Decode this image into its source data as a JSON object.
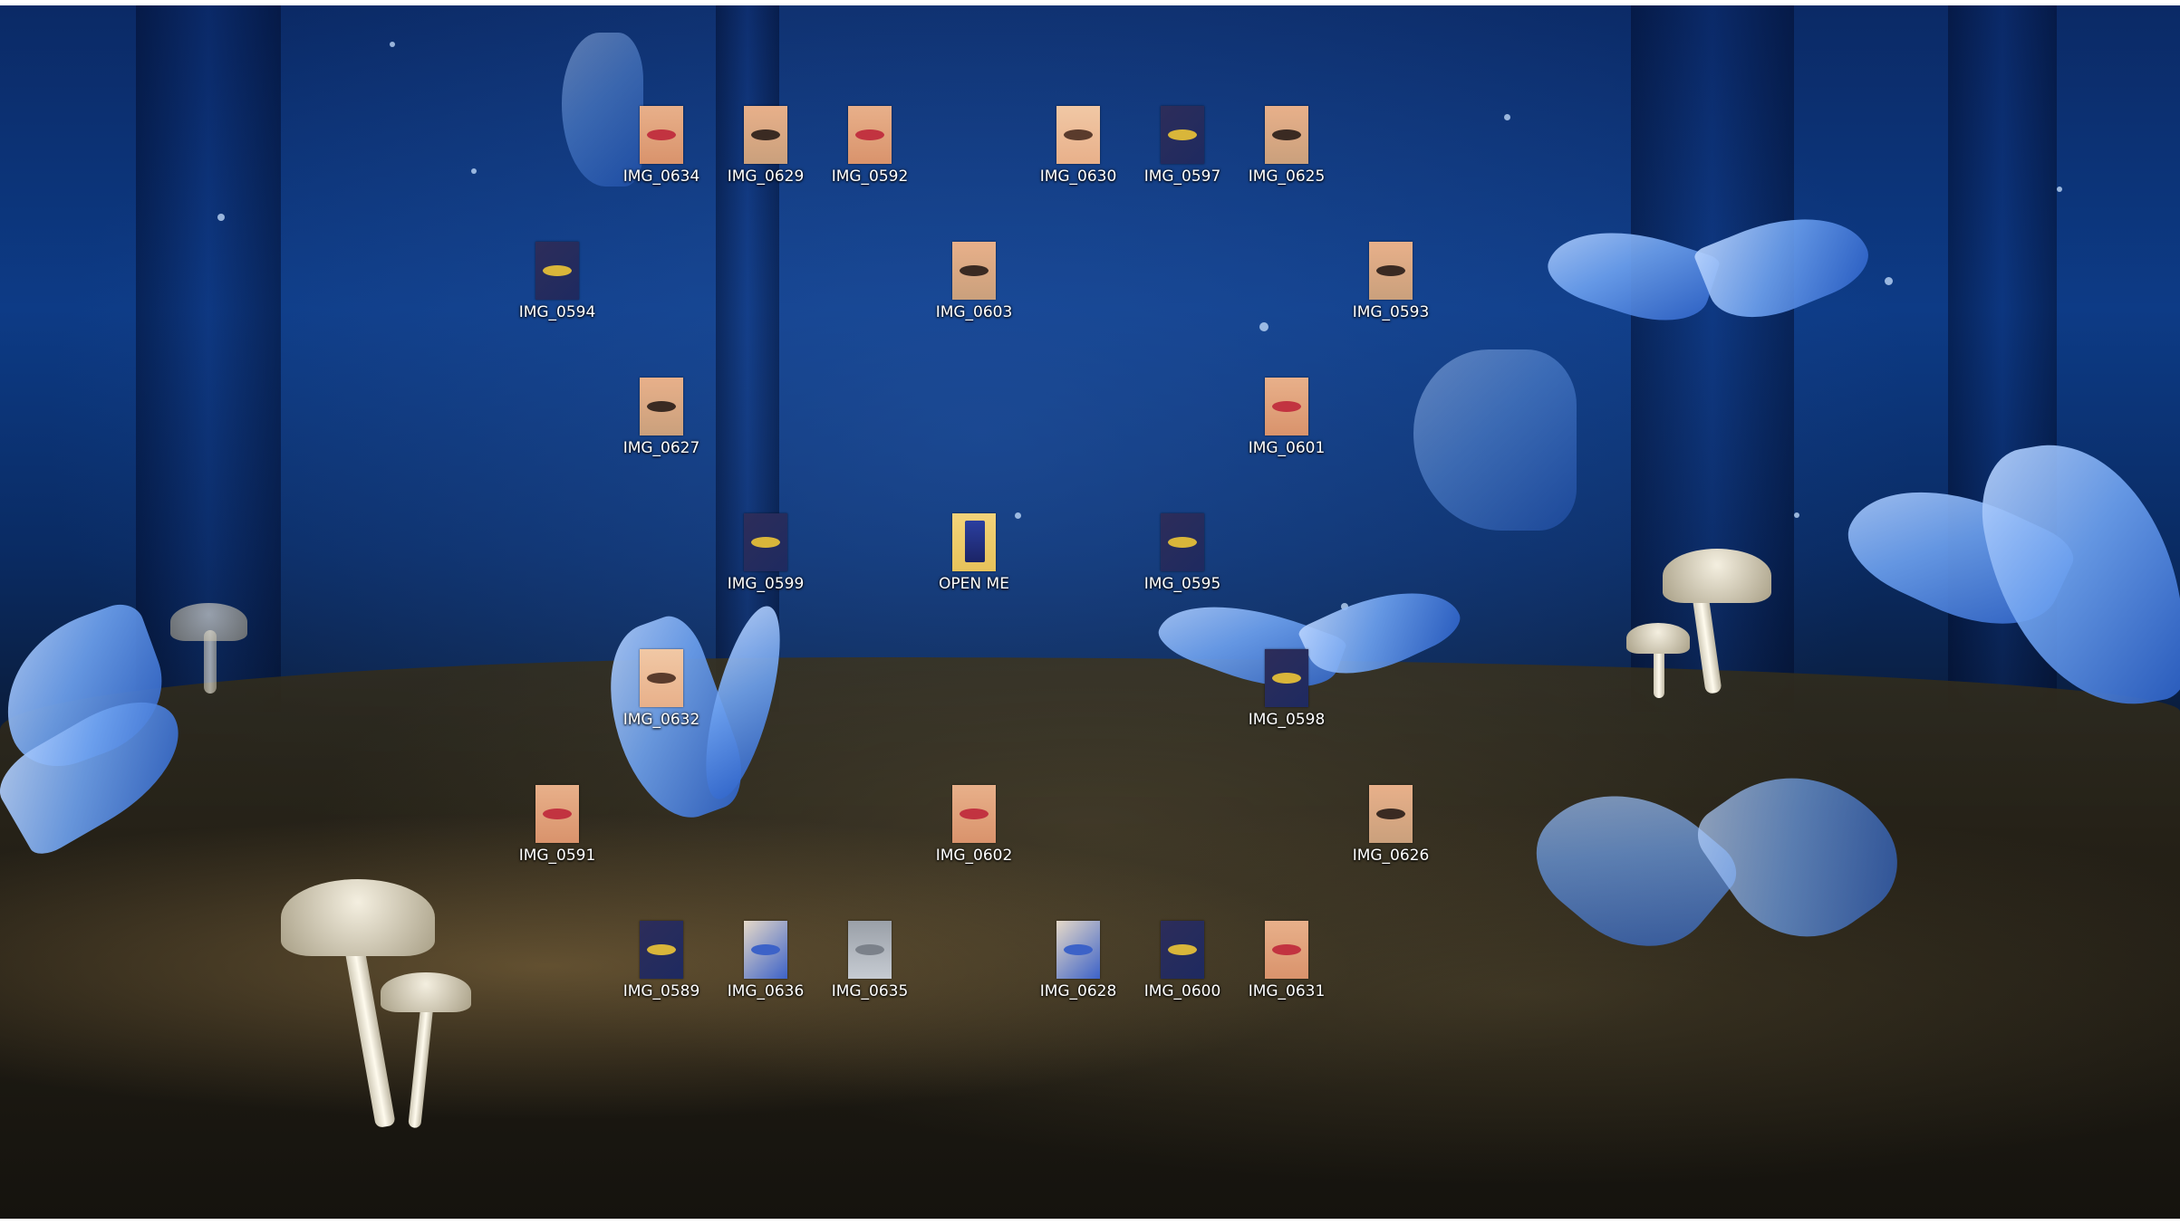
{
  "desktop": {
    "icons": [
      {
        "label": "IMG_0634",
        "type": "photo-lips"
      },
      {
        "label": "IMG_0629",
        "type": "photo-eye"
      },
      {
        "label": "IMG_0592",
        "type": "photo-lips"
      },
      {
        "label": "IMG_0630",
        "type": "photo-face"
      },
      {
        "label": "IMG_0597",
        "type": "photo-script"
      },
      {
        "label": "IMG_0625",
        "type": "photo-eye"
      },
      {
        "label": "IMG_0594",
        "type": "photo-script"
      },
      {
        "label": "IMG_0603",
        "type": "photo-eye"
      },
      {
        "label": "IMG_0593",
        "type": "photo-eye"
      },
      {
        "label": "IMG_0627",
        "type": "photo-eye"
      },
      {
        "label": "IMG_0601",
        "type": "photo-lips"
      },
      {
        "label": "IMG_0599",
        "type": "photo-script"
      },
      {
        "label": "OPEN ME",
        "type": "folder"
      },
      {
        "label": "IMG_0595",
        "type": "photo-script"
      },
      {
        "label": "IMG_0632",
        "type": "photo-face"
      },
      {
        "label": "IMG_0598",
        "type": "photo-script"
      },
      {
        "label": "IMG_0591",
        "type": "photo-lips"
      },
      {
        "label": "IMG_0602",
        "type": "photo-lips"
      },
      {
        "label": "IMG_0626",
        "type": "photo-eye"
      },
      {
        "label": "IMG_0589",
        "type": "photo-script"
      },
      {
        "label": "IMG_0636",
        "type": "photo-blue"
      },
      {
        "label": "IMG_0635",
        "type": "photo-gray"
      },
      {
        "label": "IMG_0628",
        "type": "photo-blue"
      },
      {
        "label": "IMG_0600",
        "type": "photo-script"
      },
      {
        "label": "IMG_0631",
        "type": "photo-lips"
      }
    ]
  },
  "colors": {
    "skin": "#e8b08a",
    "lips": "#c23340",
    "script_bg": "#2d2d5a",
    "script_ink": "#d9b63a",
    "folder": "#e7c25a",
    "blue_photo": "#3c62c8",
    "gray_photo": "#9aa0a8"
  }
}
